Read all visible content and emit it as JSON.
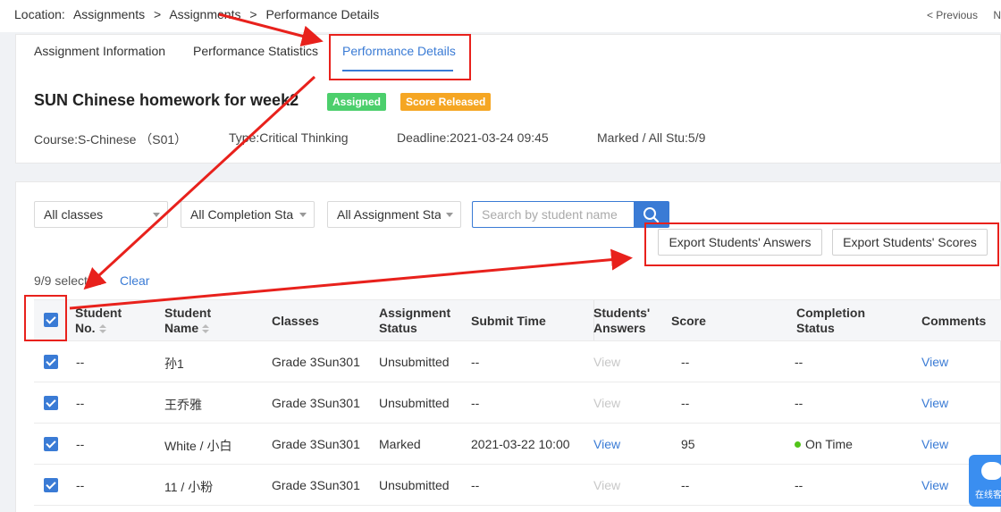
{
  "location": {
    "label": "Location:",
    "crumbs": [
      "Assignments",
      ">",
      "Assignments",
      ">",
      "Performance Details"
    ]
  },
  "pager": {
    "previous": "< Previous",
    "next": "N"
  },
  "tabs": [
    {
      "label": "Assignment Information"
    },
    {
      "label": "Performance Statistics"
    },
    {
      "label": "Performance Details"
    }
  ],
  "assignment": {
    "title": "SUN Chinese homework for week2",
    "badges": [
      {
        "label": "Assigned",
        "color": "#4ccf6c"
      },
      {
        "label": "Score Released",
        "color": "#f5a623"
      }
    ],
    "course": "Course:S-Chinese （S01）",
    "type": "Type:Critical Thinking",
    "deadline": "Deadline:2021-03-24 09:45",
    "marked": "Marked / All Stu:5/9"
  },
  "filters": {
    "classes": "All classes",
    "completion": "All Completion Sta",
    "assignment": "All Assignment Sta",
    "search_placeholder": "Search by student name"
  },
  "actions": {
    "export_answers": "Export Students' Answers",
    "export_scores": "Export Students' Scores"
  },
  "selection": {
    "info": "9/9 selected",
    "clear": "Clear"
  },
  "table": {
    "headers": {
      "student_no": [
        "Student",
        "No."
      ],
      "student_name": [
        "Student",
        "Name"
      ],
      "classes": "Classes",
      "assignment_status": [
        "Assignment",
        "Status"
      ],
      "submit_time": "Submit Time",
      "students_answers": [
        "Students'",
        "Answers"
      ],
      "score": "Score",
      "completion_status": [
        "Completion",
        "Status"
      ],
      "comments": "Comments"
    },
    "rows": [
      {
        "no": "--",
        "name": "孙1",
        "class": "Grade 3Sun301",
        "status": "Unsubmitted",
        "submit": "--",
        "answers": "View",
        "answers_enabled": false,
        "score": "--",
        "completion": "--",
        "comments": "View"
      },
      {
        "no": "--",
        "name": "王乔雅",
        "class": "Grade 3Sun301",
        "status": "Unsubmitted",
        "submit": "--",
        "answers": "View",
        "answers_enabled": false,
        "score": "--",
        "completion": "--",
        "comments": "View"
      },
      {
        "no": "--",
        "name": "White / 小白",
        "class": "Grade 3Sun301",
        "status": "Marked",
        "submit": "2021-03-22 10:00",
        "answers": "View",
        "answers_enabled": true,
        "score": "95",
        "completion": "On Time",
        "comments": "View"
      },
      {
        "no": "--",
        "name": "11 / 小粉",
        "class": "Grade 3Sun301",
        "status": "Unsubmitted",
        "submit": "--",
        "answers": "View",
        "answers_enabled": false,
        "score": "--",
        "completion": "--",
        "comments": "View"
      }
    ]
  },
  "chat": {
    "label": "在线客"
  },
  "colors": {
    "accent": "#3a7bd5",
    "annotation": "#e8211c",
    "on_time": "#52c41a"
  }
}
